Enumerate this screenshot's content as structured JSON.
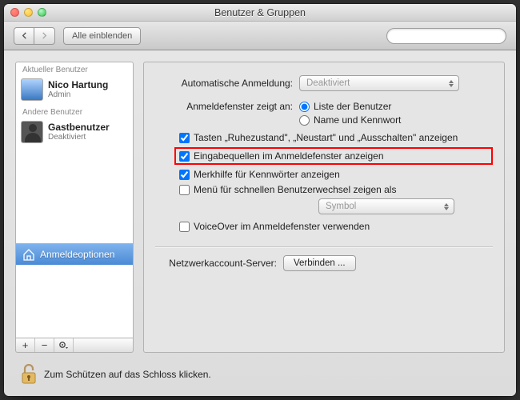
{
  "window": {
    "title": "Benutzer & Gruppen"
  },
  "toolbar": {
    "show_all": "Alle einblenden",
    "search_placeholder": ""
  },
  "sidebar": {
    "current_header": "Aktueller Benutzer",
    "other_header": "Andere Benutzer",
    "current_user": {
      "name": "Nico Hartung",
      "role": "Admin"
    },
    "other_user": {
      "name": "Gastbenutzer",
      "role": "Deaktiviert"
    },
    "login_options": "Anmeldeoptionen",
    "buttons": {
      "add": "+",
      "remove": "−"
    }
  },
  "settings": {
    "auto_login_label": "Automatische Anmeldung:",
    "auto_login_value": "Deaktiviert",
    "display_label": "Anmeldefenster zeigt an:",
    "radio_list": "Liste der Benutzer",
    "radio_name": "Name und Kennwort",
    "cb_buttons": "Tasten „Ruhezustand\", „Neustart\" und „Ausschalten\" anzeigen",
    "cb_input_sources": "Eingabequellen im Anmeldefenster anzeigen",
    "cb_hints": "Merkhilfe für Kennwörter anzeigen",
    "cb_fastswitch": "Menü für schnellen Benutzerwechsel zeigen als",
    "fast_switch_value": "Symbol",
    "cb_voiceover": "VoiceOver im Anmeldefenster verwenden",
    "network_label": "Netzwerkaccount-Server:",
    "connect": "Verbinden ..."
  },
  "lock": {
    "text": "Zum Schützen auf das Schloss klicken."
  }
}
